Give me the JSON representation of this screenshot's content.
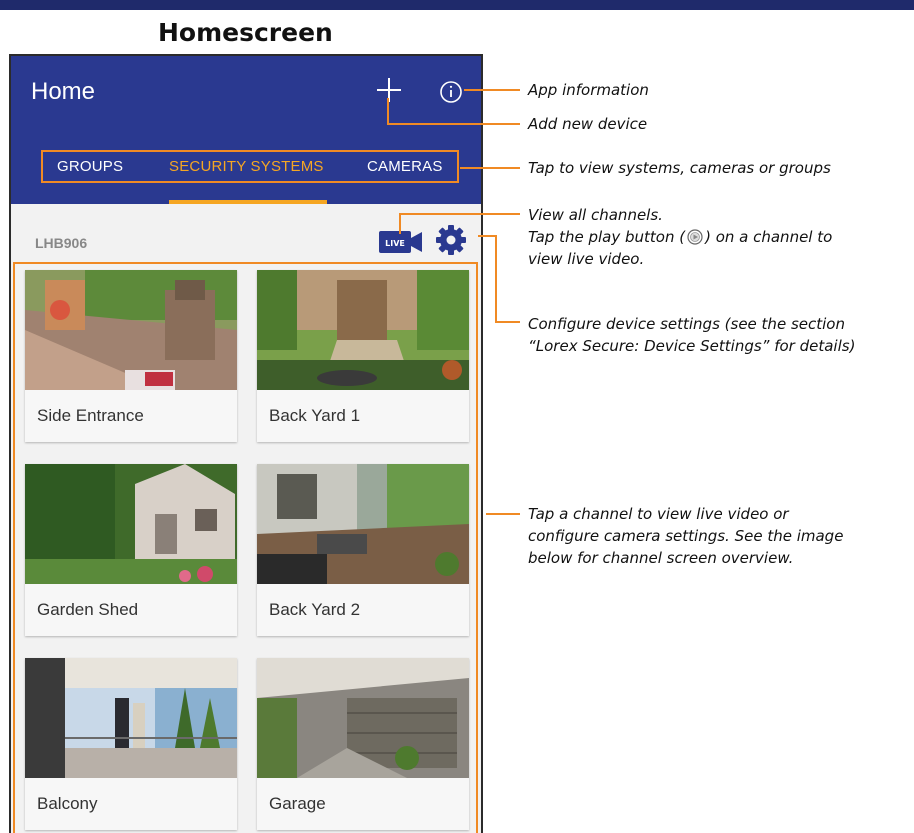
{
  "document": {
    "title": "Homescreen"
  },
  "app": {
    "title": "Home",
    "tabs": [
      {
        "label": "GROUPS",
        "active": false
      },
      {
        "label": "SECURITY SYSTEMS",
        "active": true
      },
      {
        "label": "CAMERAS",
        "active": false
      }
    ],
    "device": {
      "name": "LHB906",
      "live_label": "LIVE"
    },
    "channels": [
      {
        "label": "Side Entrance"
      },
      {
        "label": "Back Yard 1"
      },
      {
        "label": "Garden Shed"
      },
      {
        "label": "Back Yard 2"
      },
      {
        "label": "Balcony"
      },
      {
        "label": "Garage"
      }
    ]
  },
  "annotations": {
    "app_info": "App information",
    "add_device": "Add new device",
    "tabs": "Tap to view systems, cameras or groups",
    "view_channels_line1": "View all channels.",
    "view_channels_line2a": "Tap the play button (",
    "view_channels_line2b": ") on a channel to",
    "view_channels_line3": "view live video.",
    "settings_line1": "Configure device settings (see the section",
    "settings_line2": "“Lorex Secure: Device Settings” for details)",
    "channel_line1": "Tap a channel to view live video or",
    "channel_line2": "configure camera settings. See the image",
    "channel_line3": "below for channel screen overview."
  },
  "colors": {
    "appbar": "#2a3990",
    "accent": "#f5a623",
    "annotation": "#f08a24"
  }
}
